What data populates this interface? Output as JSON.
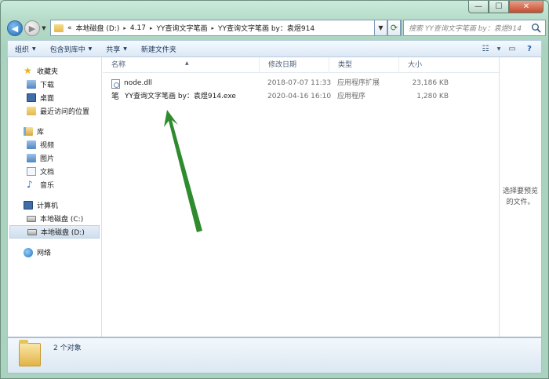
{
  "window": {
    "buttons": {
      "minimize": "—",
      "maximize": "☐",
      "close": "✕"
    }
  },
  "address": {
    "prefix": "«",
    "crumbs": [
      "本地磁盘 (D:)",
      "4.17",
      "YY查询文字笔画",
      "YY查询文字笔画 by：袁煜914"
    ],
    "separator": "▸"
  },
  "search": {
    "placeholder": "搜索 YY查询文字笔画 by：袁煜914"
  },
  "toolbar": {
    "organize": "组织",
    "include_library": "包含到库中",
    "share": "共享",
    "new_folder": "新建文件夹"
  },
  "nav": {
    "favorites": "收藏夹",
    "downloads": "下载",
    "desktop": "桌面",
    "recent": "最近访问的位置",
    "libraries": "库",
    "videos": "视频",
    "pictures": "图片",
    "documents": "文档",
    "music": "音乐",
    "computer": "计算机",
    "drive_c": "本地磁盘 (C:)",
    "drive_d": "本地磁盘 (D:)",
    "network": "网络"
  },
  "columns": {
    "name": "名称",
    "modified": "修改日期",
    "type": "类型",
    "size": "大小"
  },
  "files": [
    {
      "name": "node.dll",
      "modified": "2018-07-07 11:33",
      "type": "应用程序扩展",
      "size": "23,186 KB",
      "icon": "dll-icon"
    },
    {
      "name": "YY查询文字笔画 by：袁煜914.exe",
      "modified": "2020-04-16 16:10",
      "type": "应用程序",
      "size": "1,280 KB",
      "icon": "brush-app-icon",
      "icon_glyph": "笔"
    }
  ],
  "preview": {
    "text": "选择要预览的文件。"
  },
  "status": {
    "count": "2 个对象"
  },
  "colors": {
    "annotation_arrow": "#2e8b2e",
    "window_frame": "#b9dccb"
  }
}
